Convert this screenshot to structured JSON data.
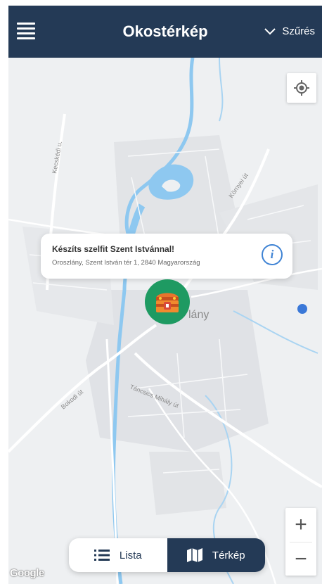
{
  "header": {
    "title": "Okostérkép",
    "filter_label": "Szűrés"
  },
  "map": {
    "street_labels": [
      "Kecskédi u.",
      "Környei út",
      "Bokodi út",
      "Táncsics Mihály út"
    ],
    "city_label": "lány",
    "popup": {
      "title": "Készíts szelfit Szent Istvánnal!",
      "address": "Oroszlány, Szent István tér 1, 2840 Magyarország"
    },
    "zoom_in_label": "+",
    "zoom_out_label": "−",
    "attribution": "Google"
  },
  "view_toggle": {
    "lista_label": "Lista",
    "terkep_label": "Térkép",
    "active": "Térkép"
  },
  "colors": {
    "header_bg": "#243a56",
    "marker": "#1e9a62",
    "water": "#8ec8f0",
    "info_accent": "#3f83d4",
    "location_dot": "#3a78d8"
  }
}
